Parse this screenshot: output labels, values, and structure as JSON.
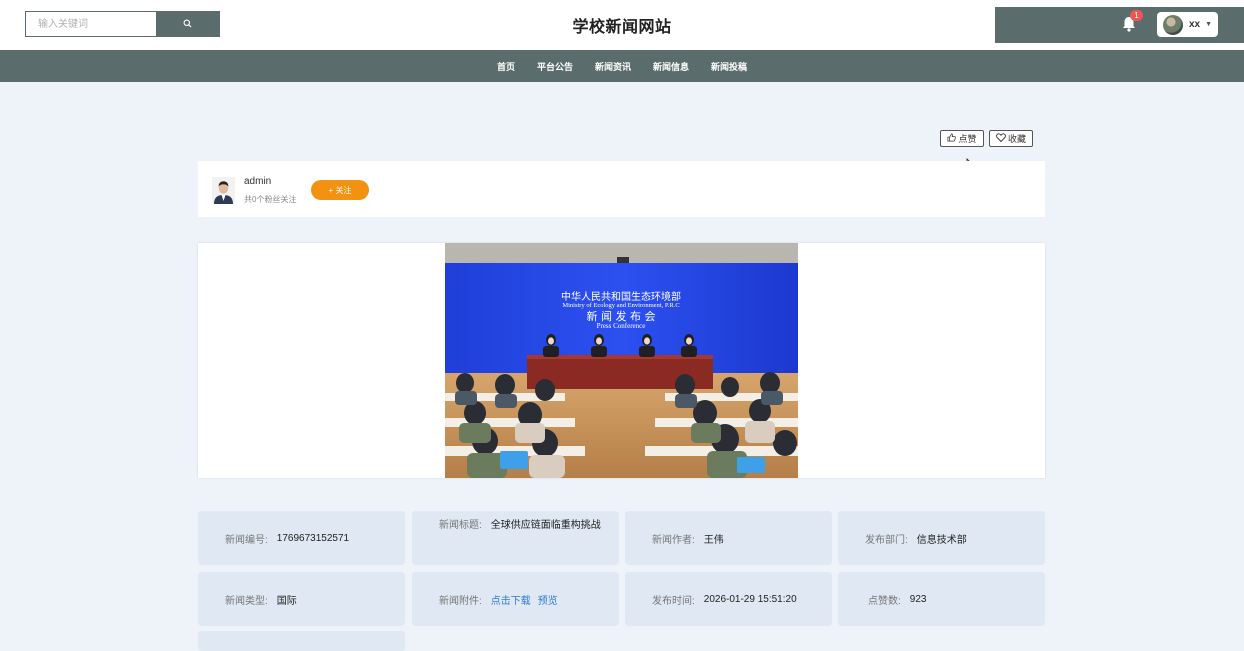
{
  "header": {
    "search_placeholder": "输入关键词",
    "site_title": "学校新闻网站",
    "notification_count": "1",
    "username": "xx"
  },
  "nav": {
    "items": [
      {
        "label": "首页"
      },
      {
        "label": "平台公告"
      },
      {
        "label": "新闻资讯"
      },
      {
        "label": "新闻信息"
      },
      {
        "label": "新闻投稿"
      }
    ]
  },
  "actions": {
    "like_label": "点赞",
    "favorite_label": "收藏"
  },
  "author": {
    "name": "admin",
    "fans_text": "共0个粉丝关注",
    "follow_label": "+ 关注"
  },
  "photo": {
    "banner_cn": "中华人民共和国生态环境部",
    "banner_en": "Ministry of Ecology and Environment, P.R.C",
    "banner_event_cn": "新 闻 发 布 会",
    "banner_event_en": "Press Conference"
  },
  "info": {
    "news_id": {
      "label": "新闻编号:",
      "value": "1769673152571"
    },
    "news_title": {
      "label": "新闻标题:",
      "value": "全球供应链面临重构挑战"
    },
    "news_author": {
      "label": "新闻作者:",
      "value": "王伟"
    },
    "department": {
      "label": "发布部门:",
      "value": "信息技术部"
    },
    "news_type": {
      "label": "新闻类型:",
      "value": "国际"
    },
    "attachment": {
      "label": "新闻附件:",
      "download": "点击下载",
      "preview": "预览"
    },
    "publish_time": {
      "label": "发布时间:",
      "value": "2026-01-29 15:51:20"
    },
    "like_count": {
      "label": "点赞数:",
      "value": "923"
    }
  },
  "colors": {
    "header_dark": "#5a6c6c",
    "page_bg": "#eef2f9",
    "info_bg": "#dfe8f3",
    "follow_orange": "#f39110",
    "badge_red": "#f05454",
    "link_blue": "#2f7ad6"
  }
}
